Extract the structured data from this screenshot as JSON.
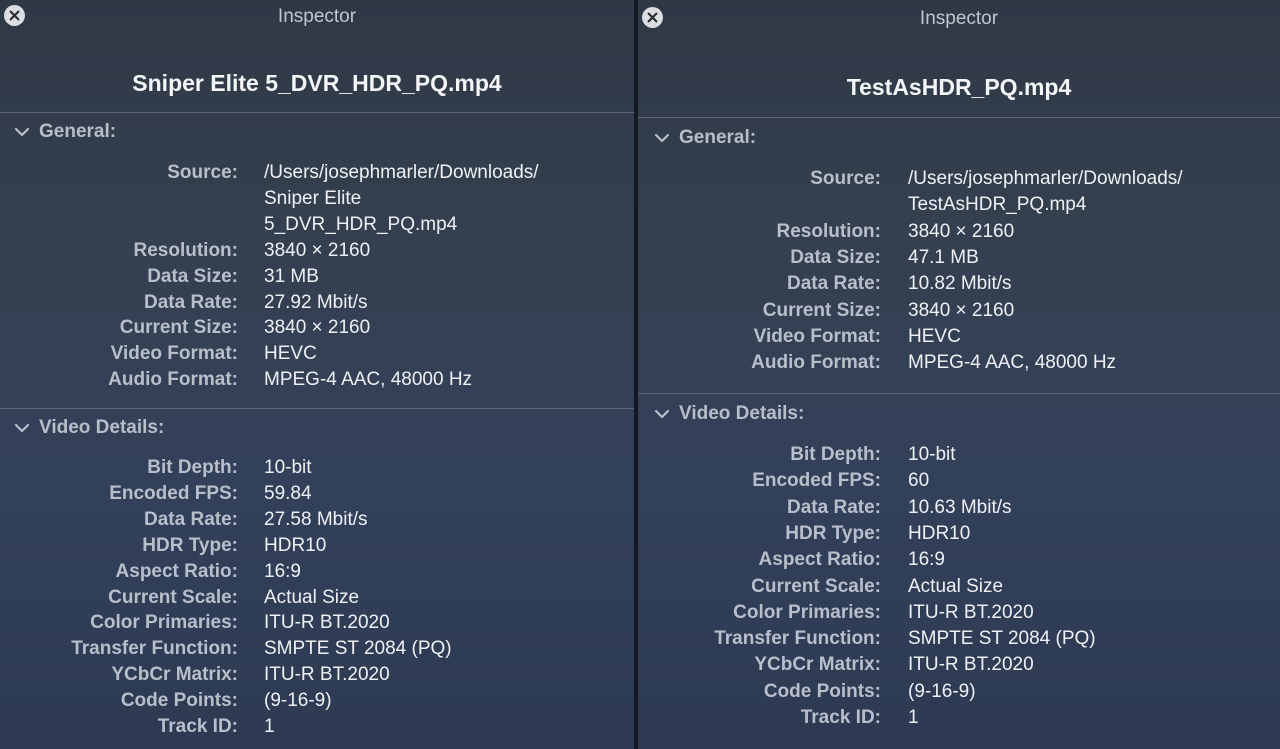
{
  "left": {
    "window_title": "Inspector",
    "filename": "Sniper Elite 5_DVR_HDR_PQ.mp4",
    "general": {
      "heading": "General:",
      "source_label": "Source:",
      "source_lines": [
        "/Users/josephmarler/Downloads/",
        "Sniper Elite",
        "5_DVR_HDR_PQ.mp4"
      ],
      "rows": [
        {
          "label": "Resolution:",
          "value": "3840 × 2160"
        },
        {
          "label": "Data Size:",
          "value": "31 MB"
        },
        {
          "label": "Data Rate:",
          "value": "27.92 Mbit/s"
        },
        {
          "label": "Current Size:",
          "value": "3840 × 2160"
        },
        {
          "label": "Video Format:",
          "value": "HEVC"
        },
        {
          "label": "Audio Format:",
          "value": "MPEG-4 AAC, 48000 Hz"
        }
      ]
    },
    "video": {
      "heading": "Video Details:",
      "rows": [
        {
          "label": "Bit Depth:",
          "value": "10-bit"
        },
        {
          "label": "Encoded FPS:",
          "value": "59.84"
        },
        {
          "label": "Data Rate:",
          "value": "27.58 Mbit/s"
        },
        {
          "label": "HDR Type:",
          "value": "HDR10"
        },
        {
          "label": "Aspect Ratio:",
          "value": "16:9"
        },
        {
          "label": "Current Scale:",
          "value": "Actual Size"
        },
        {
          "label": "Color Primaries:",
          "value": "ITU-R BT.2020"
        },
        {
          "label": "Transfer Function:",
          "value": "SMPTE ST 2084 (PQ)"
        },
        {
          "label": "YCbCr Matrix:",
          "value": "ITU-R BT.2020"
        },
        {
          "label": "Code Points:",
          "value": "(9-16-9)"
        },
        {
          "label": "Track ID:",
          "value": "1"
        }
      ]
    }
  },
  "right": {
    "window_title": "Inspector",
    "filename": "TestAsHDR_PQ.mp4",
    "general": {
      "heading": "General:",
      "source_label": "Source:",
      "source_lines": [
        "/Users/josephmarler/Downloads/",
        "TestAsHDR_PQ.mp4"
      ],
      "rows": [
        {
          "label": "Resolution:",
          "value": "3840 × 2160"
        },
        {
          "label": "Data Size:",
          "value": "47.1 MB"
        },
        {
          "label": "Data Rate:",
          "value": "10.82 Mbit/s"
        },
        {
          "label": "Current Size:",
          "value": "3840 × 2160"
        },
        {
          "label": "Video Format:",
          "value": "HEVC"
        },
        {
          "label": "Audio Format:",
          "value": "MPEG-4 AAC, 48000 Hz"
        }
      ]
    },
    "video": {
      "heading": "Video Details:",
      "rows": [
        {
          "label": "Bit Depth:",
          "value": "10-bit"
        },
        {
          "label": "Encoded FPS:",
          "value": "60"
        },
        {
          "label": "Data Rate:",
          "value": "10.63 Mbit/s"
        },
        {
          "label": "HDR Type:",
          "value": "HDR10"
        },
        {
          "label": "Aspect Ratio:",
          "value": "16:9"
        },
        {
          "label": "Current Scale:",
          "value": "Actual Size"
        },
        {
          "label": "Color Primaries:",
          "value": "ITU-R BT.2020"
        },
        {
          "label": "Transfer Function:",
          "value": "SMPTE ST 2084 (PQ)"
        },
        {
          "label": "YCbCr Matrix:",
          "value": "ITU-R BT.2020"
        },
        {
          "label": "Code Points:",
          "value": "(9-16-9)"
        },
        {
          "label": "Track ID:",
          "value": "1"
        }
      ]
    }
  }
}
